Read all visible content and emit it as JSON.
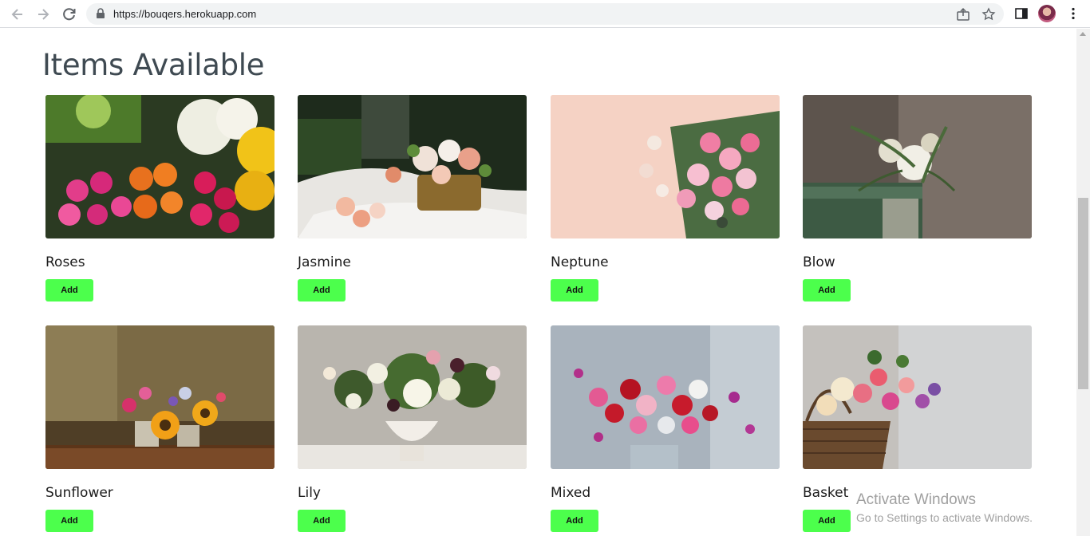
{
  "browser": {
    "url": "https://bouqers.herokuapp.com"
  },
  "page": {
    "title": "Items Available"
  },
  "items": [
    {
      "name": "Roses",
      "button": "Add"
    },
    {
      "name": "Jasmine",
      "button": "Add"
    },
    {
      "name": "Neptune",
      "button": "Add"
    },
    {
      "name": "Blow",
      "button": "Add"
    },
    {
      "name": "Sunflower",
      "button": "Add"
    },
    {
      "name": "Lily",
      "button": "Add"
    },
    {
      "name": "Mixed",
      "button": "Add"
    },
    {
      "name": "Basket",
      "button": "Add"
    }
  ],
  "watermark": {
    "title": "Activate Windows",
    "subtitle": "Go to Settings to activate Windows."
  },
  "colors": {
    "add_button": "#4cff4c",
    "heading": "#3f4a52"
  },
  "icons": [
    "back-arrow-icon",
    "forward-arrow-icon",
    "reload-icon",
    "lock-icon",
    "share-icon",
    "bookmark-star-icon",
    "side-panel-icon",
    "profile-avatar",
    "menu-kebab-icon"
  ]
}
